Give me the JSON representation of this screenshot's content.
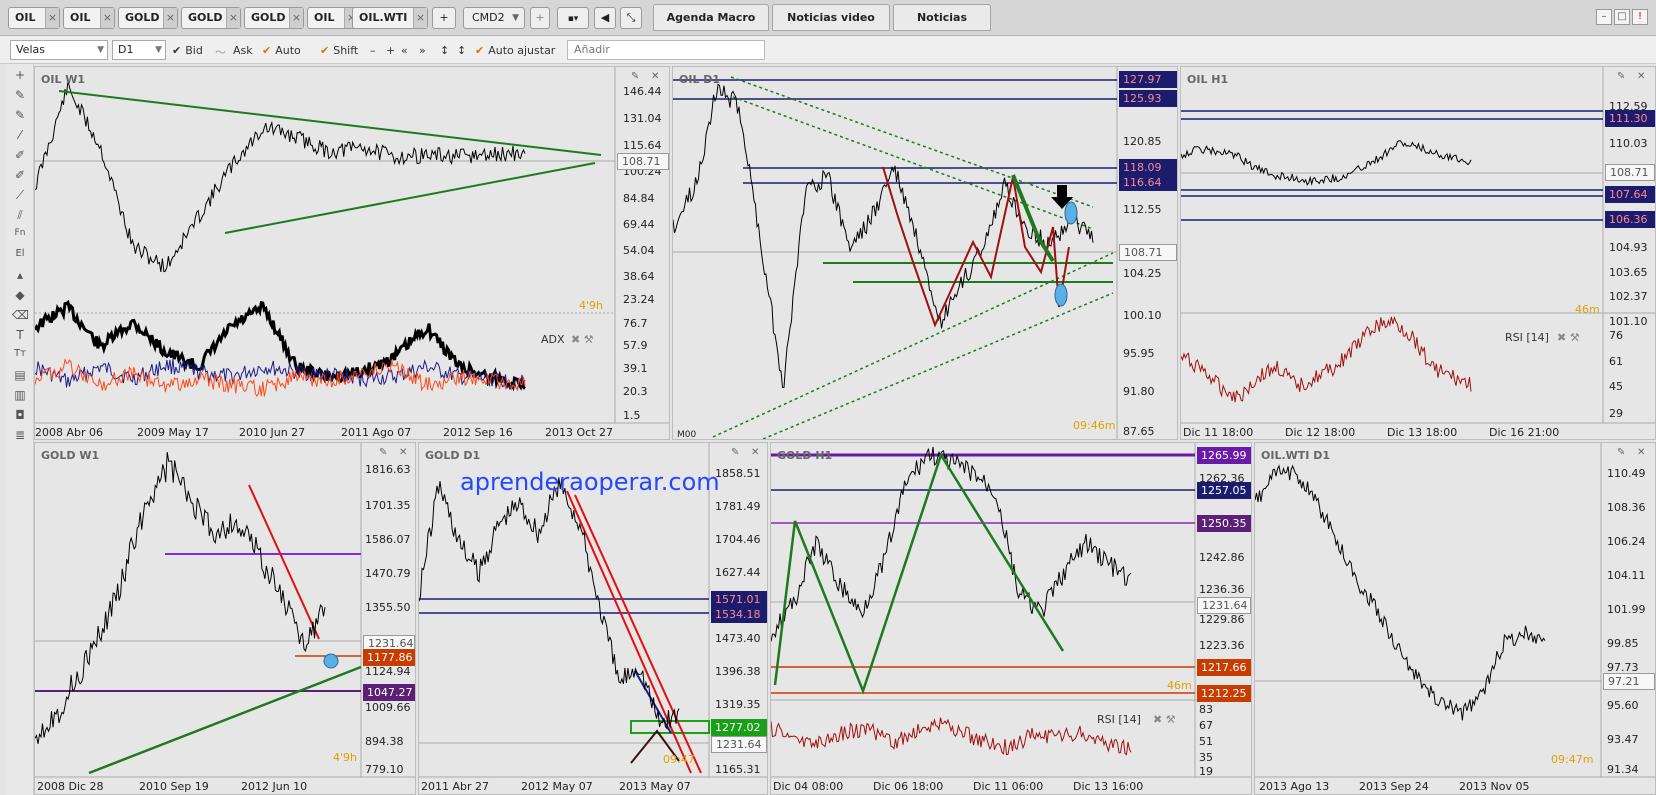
{
  "instrument_tabs": [
    "OIL",
    "OIL",
    "GOLD",
    "GOLD",
    "GOLD",
    "OIL",
    "OIL.WTI"
  ],
  "add_tab_label": "+",
  "cmd_select": "CMD2",
  "top_tabs": [
    "Agenda Macro",
    "Noticias video",
    "Noticias"
  ],
  "toolbar": {
    "chart_type": "Velas",
    "period": "D1",
    "bid_label": "Bid",
    "ask_label": "Ask",
    "auto_label": "Auto",
    "shift_label": "Shift",
    "auto_adjust_label": "Auto ajustar",
    "add_placeholder": "Añadir"
  },
  "watermark": "aprenderaoperar.com",
  "panels": {
    "oil_w1": {
      "title": "OIL W1",
      "yticks": [
        "146.44",
        "131.04",
        "115.64",
        "100.24",
        "84.84",
        "69.44",
        "54.04",
        "38.64",
        "23.24"
      ],
      "price_tag": "108.71",
      "timer": "4'9h",
      "indicator": "ADX",
      "ind_ticks": [
        "76.7",
        "57.9",
        "39.1",
        "20.3",
        "1.5"
      ],
      "xticks": [
        "2008 Abr 06",
        "2009 May 17",
        "2010 Jun 27",
        "2011 Ago 07",
        "2012 Sep 16",
        "2013 Oct 27"
      ]
    },
    "oil_d1": {
      "title": "OIL D1",
      "yticks": [
        "120.85",
        "112.55",
        "104.25",
        "100.10",
        "95.95",
        "91.80",
        "87.65"
      ],
      "tags_top": [
        "127.97",
        "125.93"
      ],
      "tags_mid": [
        "118.09",
        "116.64"
      ],
      "price_tag": "108.71",
      "timer": "09:46m",
      "mark": "M00"
    },
    "oil_h1": {
      "title": "OIL H1",
      "yticks": [
        "112.59",
        "111.30",
        "110.03",
        "107.64",
        "106.36",
        "104.93",
        "103.65",
        "102.37",
        "101.10"
      ],
      "tag_top": "111.30",
      "tags_mid": [
        "107.64",
        "106.36"
      ],
      "price_tag": "108.71",
      "timer": "46m",
      "indicator": "RSI [14]",
      "ind_ticks": [
        "76",
        "61",
        "45",
        "29"
      ],
      "xticks": [
        "Dic 11 18:00",
        "Dic 12 18:00",
        "Dic 13 18:00",
        "Dic 16 21:00"
      ]
    },
    "gold_w1": {
      "title": "GOLD W1",
      "yticks": [
        "1816.63",
        "1701.35",
        "1586.07",
        "1470.79",
        "1355.50",
        "1124.94",
        "1009.66",
        "894.38",
        "779.10"
      ],
      "price_tag": "1231.64",
      "tag_orange": "1177.86",
      "tag_purple": "1047.27",
      "timer": "4'9h",
      "xticks": [
        "2008 Dic 28",
        "2010 Sep 19",
        "2012 Jun 10"
      ]
    },
    "gold_d1": {
      "title": "GOLD D1",
      "yticks": [
        "1858.51",
        "1781.49",
        "1704.46",
        "1627.44",
        "1473.40",
        "1396.38",
        "1319.35",
        "1165.31"
      ],
      "tags_navy": [
        "1571.01",
        "1534.18"
      ],
      "tag_green": "1277.02",
      "price_tag": "1231.64",
      "timer": "09:47",
      "xticks": [
        "2011 Abr 27",
        "2012 May 07",
        "2013 May 07"
      ]
    },
    "gold_h1": {
      "title": "GOLD H1",
      "yticks": [
        "1262.36",
        "1242.86",
        "1236.36",
        "1229.86",
        "1223.36"
      ],
      "tag_violet": "1265.99",
      "tag_navy": "1257.05",
      "tag_purple": "1250.35",
      "price_tag": "1231.64",
      "tags_orange": [
        "1217.66",
        "1212.25"
      ],
      "timer": "46m",
      "indicator": "RSI [14]",
      "ind_ticks": [
        "83",
        "67",
        "51",
        "35",
        "19"
      ],
      "xticks": [
        "Dic 04 08:00",
        "Dic 06 18:00",
        "Dic 11 06:00",
        "Dic 13 16:00"
      ]
    },
    "oilwti_d1": {
      "title": "OIL.WTI D1",
      "yticks": [
        "110.49",
        "108.36",
        "106.24",
        "104.11",
        "101.99",
        "99.85",
        "97.73",
        "95.60",
        "93.47",
        "91.34"
      ],
      "price_tag": "97.21",
      "timer": "09:47m",
      "xticks": [
        "2013 Ago 13",
        "2013 Sep 24",
        "2013 Nov 05"
      ]
    }
  }
}
